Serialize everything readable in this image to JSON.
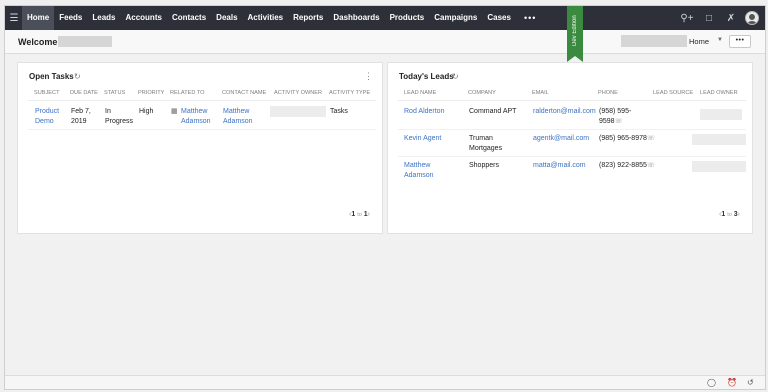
{
  "nav": {
    "menu_icon": "hamburger-icon",
    "items": [
      {
        "label": "Home"
      },
      {
        "label": "Feeds"
      },
      {
        "label": "Leads"
      },
      {
        "label": "Accounts"
      },
      {
        "label": "Contacts"
      },
      {
        "label": "Deals"
      },
      {
        "label": "Activities"
      },
      {
        "label": "Reports"
      },
      {
        "label": "Dashboards"
      },
      {
        "label": "Products"
      },
      {
        "label": "Campaigns"
      },
      {
        "label": "Cases"
      }
    ],
    "more_label": "•••",
    "active_index": 0
  },
  "ribbon": {
    "label": "Dev Edition",
    "color": "#3a8a3f"
  },
  "header": {
    "welcome": "Welcome",
    "home_select": "Home",
    "more_label": "•••"
  },
  "open_tasks": {
    "title": "Open Tasks",
    "columns": [
      "SUBJECT",
      "DUE DATE",
      "STATUS",
      "PRIORITY",
      "RELATED TO",
      "CONTACT NAME",
      "ACTIVITY OWNER",
      "ACTIVITY TYPE"
    ],
    "rows": [
      {
        "subject": [
          "Product",
          "Demo"
        ],
        "due_date": [
          "Feb 7,",
          "2019"
        ],
        "status": [
          "In",
          "Progress"
        ],
        "priority": "High",
        "related_to": [
          "Matthew",
          "Adamson"
        ],
        "contact_name": [
          "Matthew",
          "Adamson"
        ],
        "activity_type": "Tasks"
      }
    ],
    "pager": {
      "from": "1",
      "to_label": "to",
      "to": "1"
    }
  },
  "todays_leads": {
    "title": "Today's Leads",
    "columns": [
      "LEAD NAME",
      "COMPANY",
      "EMAIL",
      "PHONE",
      "LEAD SOURCE",
      "LEAD OWNER"
    ],
    "rows": [
      {
        "name": [
          "Rod Alderton"
        ],
        "company": [
          "Command APT"
        ],
        "email": "ralderton@mail.com",
        "phone": [
          "(958) 595-",
          "9598"
        ]
      },
      {
        "name": [
          "Kevin Agent"
        ],
        "company": [
          "Truman",
          "Mortgages"
        ],
        "email": "agentk@mail.com",
        "phone": [
          "(985) 965-8978"
        ]
      },
      {
        "name": [
          "Matthew",
          "Adamson"
        ],
        "company": [
          "Shoppers"
        ],
        "email": "matta@mail.com",
        "phone": [
          "(823) 922-8855"
        ]
      }
    ],
    "pager": {
      "from": "1",
      "to_label": "to",
      "to": "3"
    }
  },
  "colors": {
    "nav_bg": "#2d3038",
    "link": "#3b72c4"
  }
}
